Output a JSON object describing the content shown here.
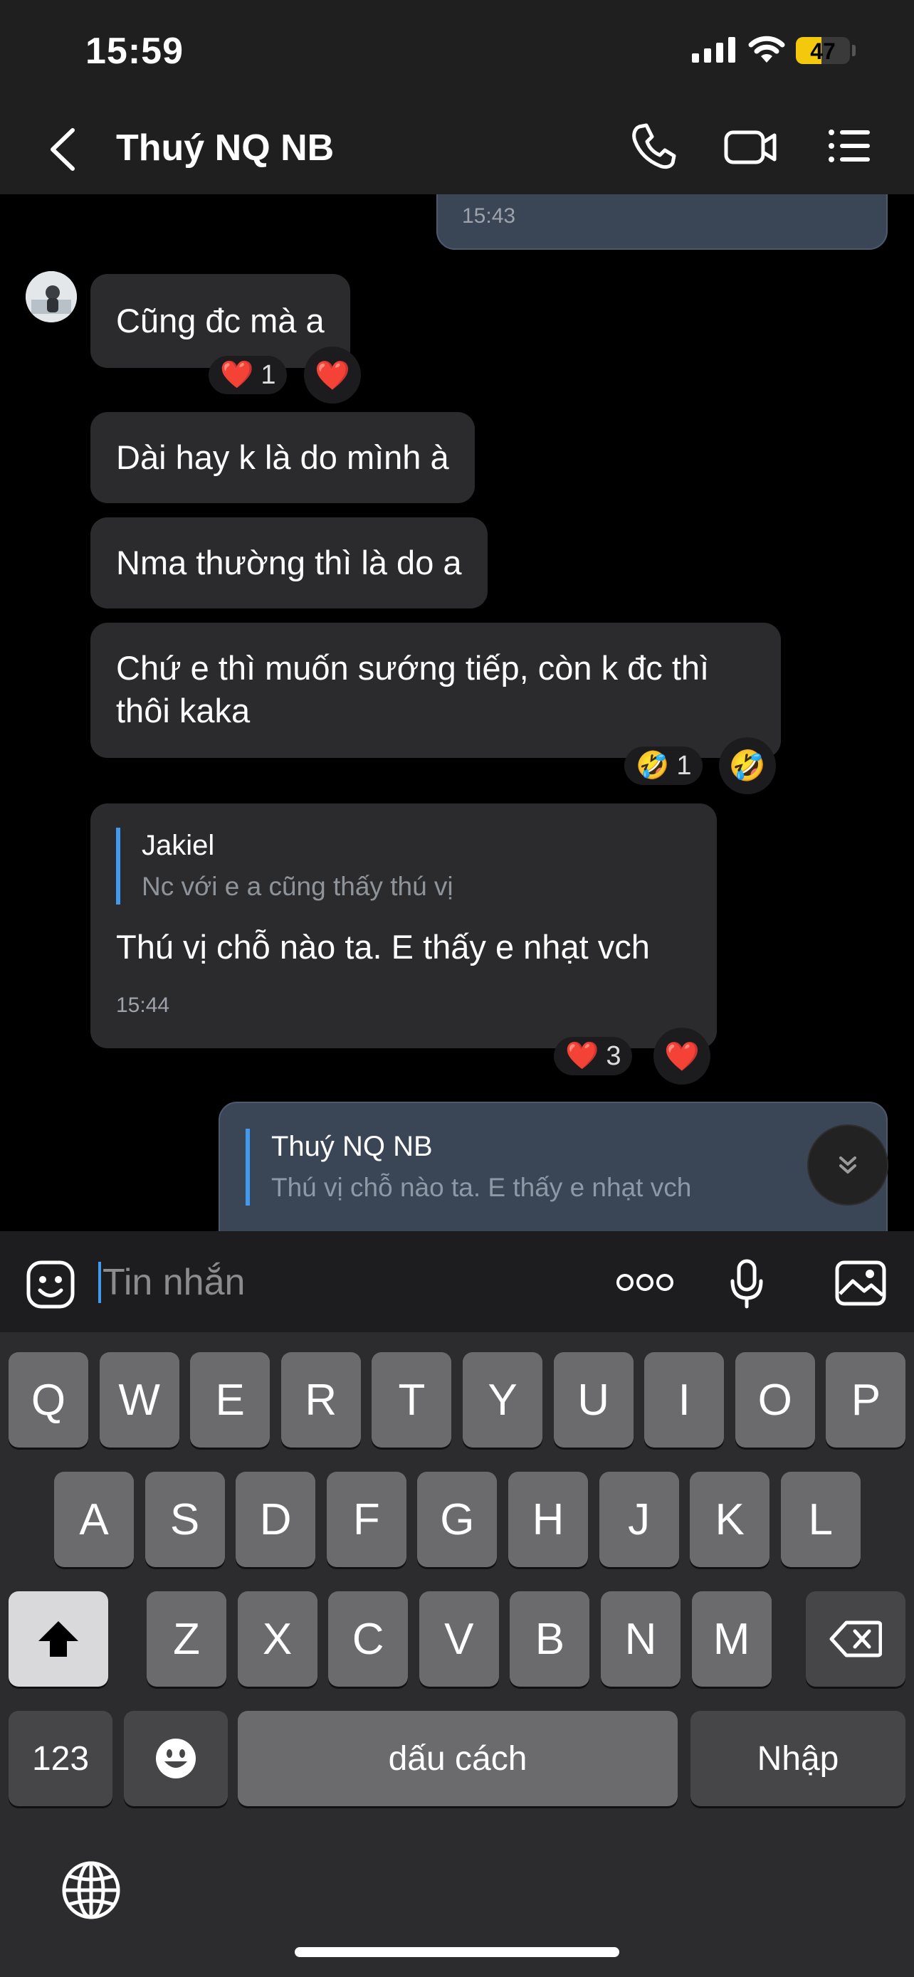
{
  "status_bar": {
    "time": "15:59",
    "battery": "47",
    "battery_level": 0.47
  },
  "header": {
    "title": "Thuý NQ NB",
    "call_icon": "phone-icon",
    "video_icon": "video-icon",
    "menu_icon": "list-menu-icon"
  },
  "messages": {
    "prev_out_time": "15:43",
    "m1": {
      "text": "Cũng đc mà a",
      "reaction": "❤️",
      "reaction_count": "1"
    },
    "m2": {
      "text": "Dài hay k là do mình à"
    },
    "m3": {
      "text": "Nma thường thì là do a"
    },
    "m4": {
      "line1": "Chứ e thì muốn sướng tiếp, còn k đc thì",
      "line2": "thôi kaka",
      "reaction": "🤣",
      "reaction_count": "1"
    },
    "m5": {
      "reply_name": "Jakiel",
      "reply_text": "Nc với e a cũng thấy thú vị",
      "text": "Thú vị chỗ nào ta. E thấy e nhạt vch",
      "time": "15:44",
      "reaction": "❤️",
      "reaction_count": "3"
    },
    "m6": {
      "reply_name": "Thuý NQ NB",
      "reply_text": "Thú vị chỗ nào ta. E thấy e nhạt vch"
    }
  },
  "input": {
    "placeholder": "Tin nhắn",
    "icons": [
      "sticker-icon",
      "more-icon",
      "microphone-icon",
      "image-icon"
    ]
  },
  "keyboard": {
    "row1": [
      "Q",
      "W",
      "E",
      "R",
      "T",
      "Y",
      "U",
      "I",
      "O",
      "P"
    ],
    "row2": [
      "A",
      "S",
      "D",
      "F",
      "G",
      "H",
      "J",
      "K",
      "L"
    ],
    "row3": [
      "Z",
      "X",
      "C",
      "V",
      "B",
      "N",
      "M"
    ],
    "numbers": "123",
    "space": "dấu cách",
    "enter": "Nhập"
  },
  "colors": {
    "incoming_bubble": "#2b2b2d",
    "outgoing_bubble": "#3a4556",
    "accent": "#3f9af0",
    "battery": "#f3c80d"
  }
}
